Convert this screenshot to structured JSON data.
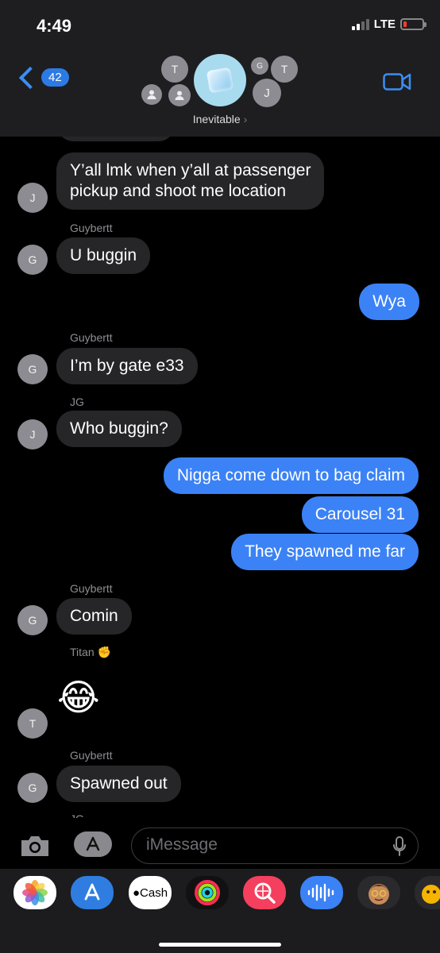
{
  "status_bar": {
    "time": "4:49",
    "network": "LTE"
  },
  "nav": {
    "back_count": "42",
    "group_name": "Inevitable",
    "group_chevron": "›",
    "participants": [
      "T",
      "G",
      "T",
      "J"
    ]
  },
  "messages": [
    {
      "dir": "in",
      "avatar": "J",
      "lines": [
        "Y’all lmk when y’all at passenger",
        "pickup and shoot me location"
      ]
    },
    {
      "sender": "Guybertt"
    },
    {
      "dir": "in",
      "avatar": "G",
      "text": "U buggin"
    },
    {
      "dir": "out",
      "text": "Wya"
    },
    {
      "sender": "Guybertt"
    },
    {
      "dir": "in",
      "avatar": "G",
      "text": "I’m by gate e33"
    },
    {
      "sender": "JG"
    },
    {
      "dir": "in",
      "avatar": "J",
      "text": "Who buggin?"
    },
    {
      "dir": "out",
      "text": "Nigga come down to bag claim"
    },
    {
      "dir": "out",
      "text": "Carousel 31"
    },
    {
      "dir": "out",
      "text": "They spawned me far"
    },
    {
      "sender": "Guybertt"
    },
    {
      "dir": "in",
      "avatar": "G",
      "text": "Comin"
    },
    {
      "sender": "Titan",
      "sender_emoji": "✊"
    },
    {
      "dir": "in",
      "avatar": "T",
      "emoji": "😂"
    },
    {
      "sender": "Guybertt"
    },
    {
      "dir": "in",
      "avatar": "G",
      "text": "Spawned out"
    },
    {
      "sender": "JG"
    }
  ],
  "composer": {
    "placeholder": "iMessage"
  },
  "app_strip": {
    "apps": [
      "photos-icon",
      "app-store-icon",
      "apple-cash-icon",
      "activity-icon",
      "search-images-icon",
      "audio-message-icon",
      "memoji-icon",
      "memoji-icon"
    ],
    "cash_label": "Cash"
  },
  "colors": {
    "outgoing": "#3b82f6",
    "incoming": "#262628",
    "accent": "#3b8ef3",
    "header": "#1e1e20"
  }
}
